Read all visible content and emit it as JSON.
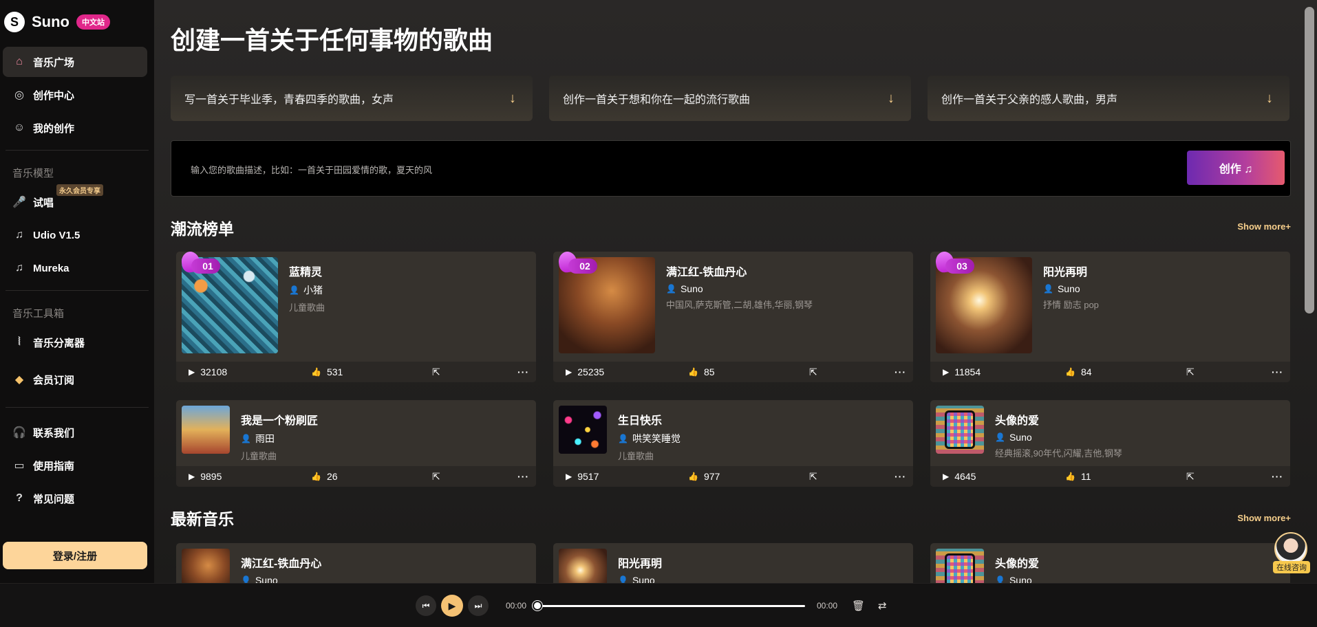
{
  "brand": {
    "name": "Suno",
    "badge": "中文站"
  },
  "sidebar": {
    "items_top": [
      {
        "label": "音乐广场",
        "icon": "home-icon"
      },
      {
        "label": "创作中心",
        "icon": "disc-icon"
      },
      {
        "label": "我的创作",
        "icon": "user-icon"
      }
    ],
    "model_section": "音乐模型",
    "vip_badge": "永久会员专享",
    "items_model": [
      {
        "label": "试唱",
        "icon": "microphone-icon"
      },
      {
        "label": "Udio V1.5",
        "icon": "music-note-icon"
      },
      {
        "label": "Mureka",
        "icon": "music-note-icon"
      }
    ],
    "tools_section": "音乐工具箱",
    "items_tools": [
      {
        "label": "音乐分离器",
        "icon": "audio-wave-icon"
      },
      {
        "label": "会员订阅",
        "icon": "diamond-icon"
      }
    ],
    "items_bottom": [
      {
        "label": "联系我们",
        "icon": "headset-icon"
      },
      {
        "label": "使用指南",
        "icon": "book-icon"
      },
      {
        "label": "常见问题",
        "icon": "question-icon"
      }
    ],
    "login_label": "登录/注册"
  },
  "main": {
    "title": "创建一首关于任何事物的歌曲",
    "prompts": [
      "写一首关于毕业季，青春四季的歌曲，女声",
      "创作一首关于想和你在一起的流行歌曲",
      "创作一首关于父亲的感人歌曲，男声"
    ],
    "input_placeholder": "输入您的歌曲描述，比如：一首关于田园爱情的歌，夏天的风",
    "create_label": "创作 ♫",
    "trending": {
      "title": "潮流榜单",
      "show_more": "Show more+",
      "top": [
        {
          "rank": "01",
          "title": "蓝精灵",
          "artist": "小猪",
          "tags": "儿童歌曲",
          "plays": "32108",
          "likes": "531"
        },
        {
          "rank": "02",
          "title": "满江红-铁血丹心",
          "artist": "Suno",
          "tags": "中国风,萨克斯管,二胡,雄伟,华丽,钢琴",
          "plays": "25235",
          "likes": "85"
        },
        {
          "rank": "03",
          "title": "阳光再明",
          "artist": "Suno",
          "tags": "抒情 励志 pop",
          "plays": "11854",
          "likes": "84"
        }
      ],
      "rest": [
        {
          "title": "我是一个粉刷匠",
          "artist": "雨田",
          "tags": "儿童歌曲",
          "plays": "9895",
          "likes": "26"
        },
        {
          "title": "生日快乐",
          "artist": "哄笑笑睡觉",
          "tags": "儿童歌曲",
          "plays": "9517",
          "likes": "977"
        },
        {
          "title": "头像的爱",
          "artist": "Suno",
          "tags": "经典摇滚,90年代,闪耀,吉他,钢琴",
          "plays": "4645",
          "likes": "11"
        }
      ]
    },
    "latest": {
      "title": "最新音乐",
      "show_more": "Show more+",
      "items": [
        {
          "title": "满江红-铁血丹心",
          "artist": "Suno"
        },
        {
          "title": "阳光再明",
          "artist": "Suno"
        },
        {
          "title": "头像的爱",
          "artist": "Suno"
        }
      ]
    }
  },
  "player": {
    "current_time": "00:00",
    "total_time": "00:00",
    "progress": 0
  },
  "consult_label": "在线咨询",
  "colors": {
    "accent": "#fdd59a",
    "show_more": "#f7cf8c",
    "rank": "#c026d3"
  }
}
